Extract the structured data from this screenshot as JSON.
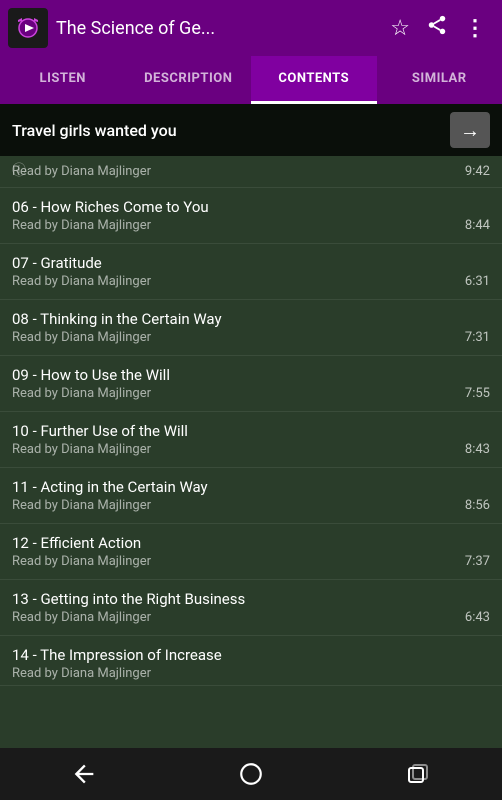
{
  "appBar": {
    "title": "The Science of Ge...",
    "starIcon": "☆",
    "shareIcon": "⎋",
    "overflowIcon": "⋮"
  },
  "tabs": [
    {
      "id": "listen",
      "label": "LISTEN",
      "active": false
    },
    {
      "id": "description",
      "label": "DESCRIPTION",
      "active": false
    },
    {
      "id": "contents",
      "label": "CONTENTS",
      "active": true
    },
    {
      "id": "similar",
      "label": "SIMILAR",
      "active": false
    }
  ],
  "nowPlaying": {
    "title": "Travel girls wanted you",
    "arrowIcon": "→"
  },
  "tracks": [
    {
      "id": "05",
      "title": "",
      "titleText": "",
      "author": "Read by Diana Majlinger",
      "duration": "9:42",
      "partialTop": true
    },
    {
      "id": "06",
      "title": "06 - How Riches Come to You",
      "author": "Read by Diana Majlinger",
      "duration": "8:44"
    },
    {
      "id": "07",
      "title": "07 - Gratitude",
      "author": "Read by Diana Majlinger",
      "duration": "6:31"
    },
    {
      "id": "08",
      "title": "08 - Thinking in the Certain Way",
      "author": "Read by Diana Majlinger",
      "duration": "7:31"
    },
    {
      "id": "09",
      "title": "09 - How to Use the Will",
      "author": "Read by Diana Majlinger",
      "duration": "7:55"
    },
    {
      "id": "10",
      "title": "10 - Further Use of the Will",
      "author": "Read by Diana Majlinger",
      "duration": "8:43"
    },
    {
      "id": "11",
      "title": "11 - Acting in the Certain Way",
      "author": "Read by Diana Majlinger",
      "duration": "8:56"
    },
    {
      "id": "12",
      "title": "12 - Efficient Action",
      "author": "Read by Diana Majlinger",
      "duration": "7:37"
    },
    {
      "id": "13",
      "title": "13 - Getting into the Right Business",
      "author": "Read by Diana Majlinger",
      "duration": "6:43"
    },
    {
      "id": "14",
      "title": "14 - The Impression of Increase",
      "author": "Read by Diana Majlinger",
      "duration": ""
    }
  ],
  "bottomNav": {
    "backIcon": "◁",
    "homeIcon": "⬜",
    "recentIcon": "▣"
  }
}
